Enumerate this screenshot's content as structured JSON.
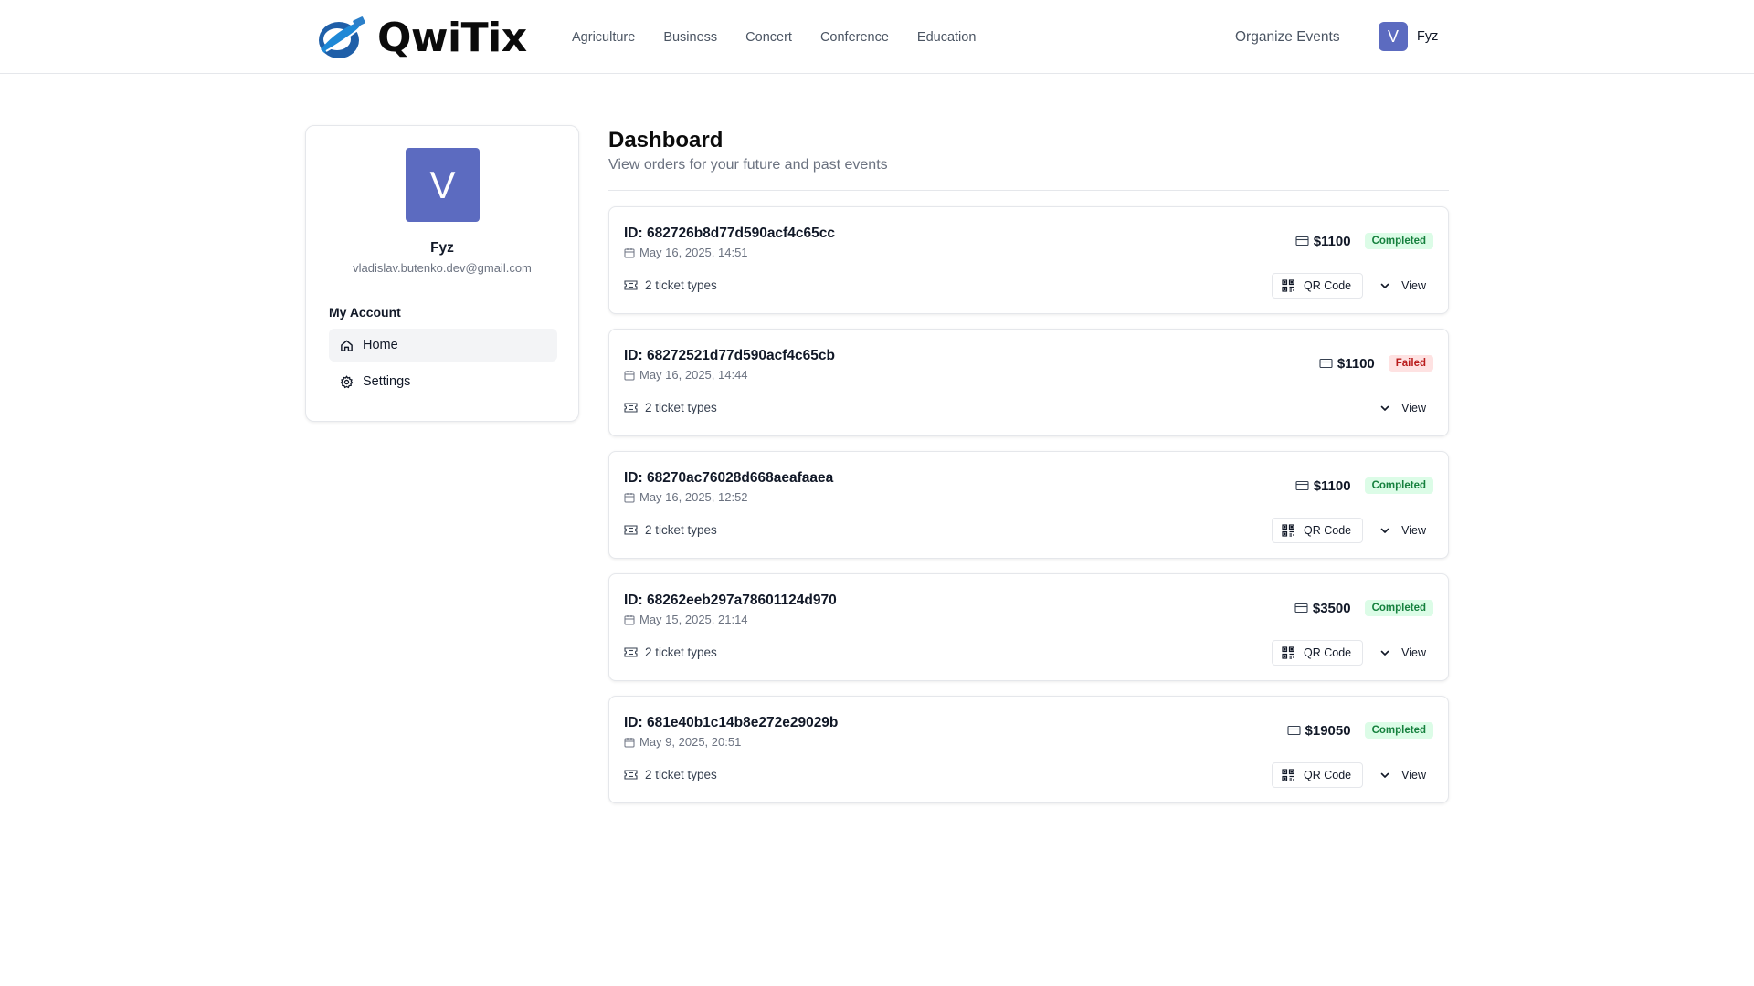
{
  "header": {
    "brand": "QwiTix",
    "nav": [
      "Agriculture",
      "Business",
      "Concert",
      "Conference",
      "Education"
    ],
    "organize_label": "Organize Events",
    "user_initial": "V",
    "user_name": "Fyz"
  },
  "sidebar": {
    "avatar_initial": "V",
    "name": "Fyz",
    "email": "vladislav.butenko.dev@gmail.com",
    "section_title": "My Account",
    "items": [
      {
        "label": "Home",
        "icon": "home-icon",
        "active": true
      },
      {
        "label": "Settings",
        "icon": "gear-icon",
        "active": false
      }
    ]
  },
  "main": {
    "title": "Dashboard",
    "subtitle": "View orders for your future and past events",
    "qr_label": "QR Code",
    "view_label": "View",
    "orders": [
      {
        "id": "ID: 682726b8d77d590acf4c65cc",
        "date": "May 16, 2025, 14:51",
        "amount": "$1100",
        "status": "Completed",
        "ticket_types": "2 ticket types",
        "has_qr": true
      },
      {
        "id": "ID: 68272521d77d590acf4c65cb",
        "date": "May 16, 2025, 14:44",
        "amount": "$1100",
        "status": "Failed",
        "ticket_types": "2 ticket types",
        "has_qr": false
      },
      {
        "id": "ID: 68270ac76028d668aeafaaea",
        "date": "May 16, 2025, 12:52",
        "amount": "$1100",
        "status": "Completed",
        "ticket_types": "2 ticket types",
        "has_qr": true
      },
      {
        "id": "ID: 68262eeb297a78601124d970",
        "date": "May 15, 2025, 21:14",
        "amount": "$3500",
        "status": "Completed",
        "ticket_types": "2 ticket types",
        "has_qr": true
      },
      {
        "id": "ID: 681e40b1c14b8e272e29029b",
        "date": "May 9, 2025, 20:51",
        "amount": "$19050",
        "status": "Completed",
        "ticket_types": "2 ticket types",
        "has_qr": true
      }
    ]
  },
  "colors": {
    "accent": "#5c6bc0",
    "completed_bg": "#dcfce7",
    "completed_text": "#15803d",
    "failed_bg": "#fee2e2",
    "failed_text": "#b91c1c"
  }
}
